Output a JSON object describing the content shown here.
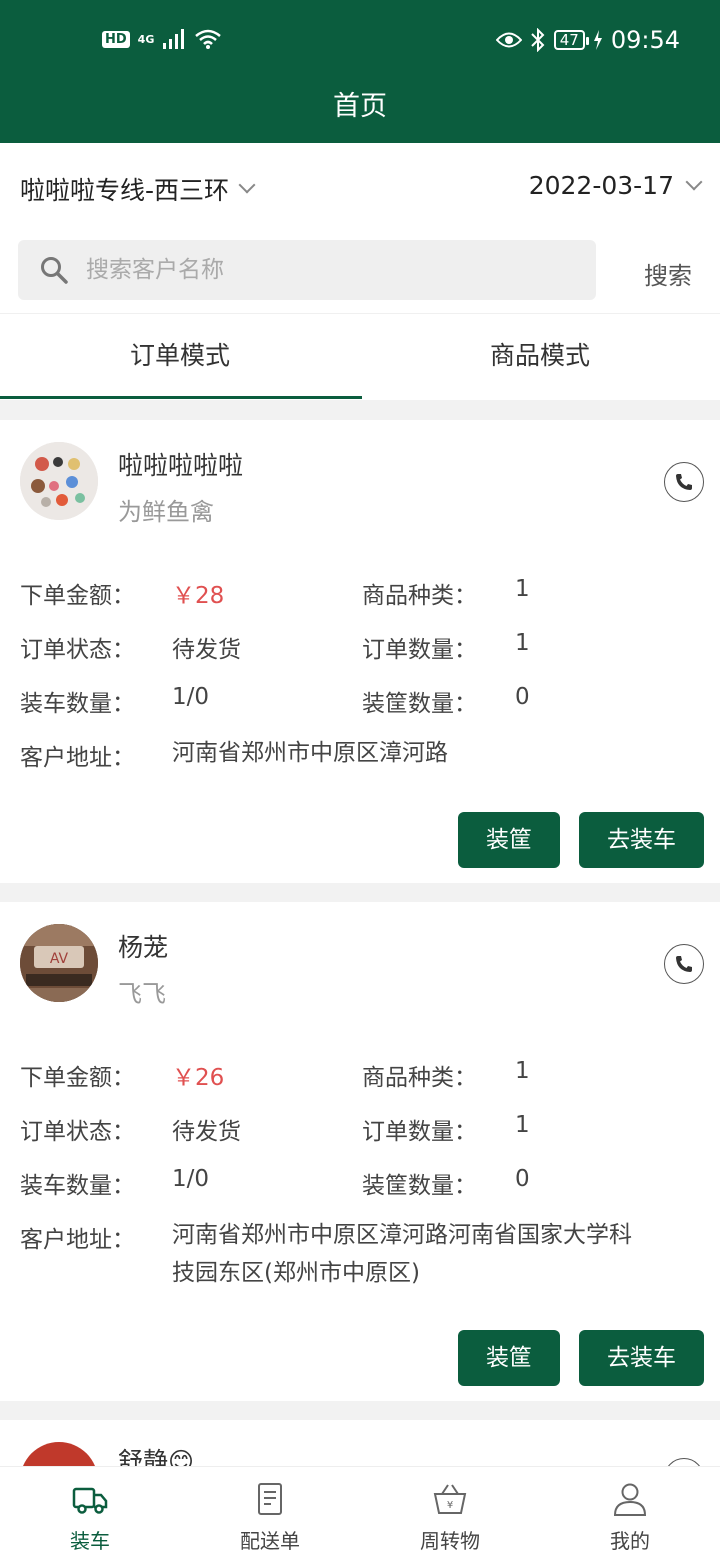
{
  "status_bar": {
    "hd": "HD",
    "network": "4G",
    "battery": "47",
    "time": "09:54"
  },
  "header": {
    "title": "首页"
  },
  "filters": {
    "route": "啦啦啦专线-西三环",
    "date": "2022-03-17"
  },
  "search": {
    "placeholder": "搜索客户名称",
    "button_label": "搜索"
  },
  "tabs": [
    {
      "label": "订单模式",
      "active": true
    },
    {
      "label": "商品模式",
      "active": false
    }
  ],
  "field_labels": {
    "amount": "下单金额：",
    "category": "商品种类：",
    "status": "订单状态：",
    "quantity": "订单数量：",
    "load_qty": "装车数量：",
    "basket_qty": "装筐数量：",
    "address": "客户地址："
  },
  "orders": [
    {
      "customer_name": "啦啦啦啦啦",
      "customer_sub": "为鲜鱼禽",
      "amount": "￥28",
      "category": "1",
      "status": "待发货",
      "quantity": "1",
      "load_qty": "1/0",
      "basket_qty": "0",
      "address": "河南省郑州市中原区漳河路",
      "basket_button": "装筐",
      "load_button": "去装车"
    },
    {
      "customer_name": "杨茏",
      "customer_sub": "飞飞",
      "amount": "￥26",
      "category": "1",
      "status": "待发货",
      "quantity": "1",
      "load_qty": "1/0",
      "basket_qty": "0",
      "address": "河南省郑州市中原区漳河路河南省国家大学科技园东区(郑州市中原区)",
      "basket_button": "装筐",
      "load_button": "去装车"
    },
    {
      "customer_name": "舒静😊"
    }
  ],
  "bottom_nav": [
    {
      "label": "装车",
      "icon": "truck-icon",
      "active": true
    },
    {
      "label": "配送单",
      "icon": "receipt-icon",
      "active": false
    },
    {
      "label": "周转物",
      "icon": "basket-icon",
      "active": false
    },
    {
      "label": "我的",
      "icon": "user-icon",
      "active": false
    }
  ],
  "colors": {
    "primary": "#0b5d3e",
    "price": "#e05050",
    "background": "#f2f2f2"
  }
}
